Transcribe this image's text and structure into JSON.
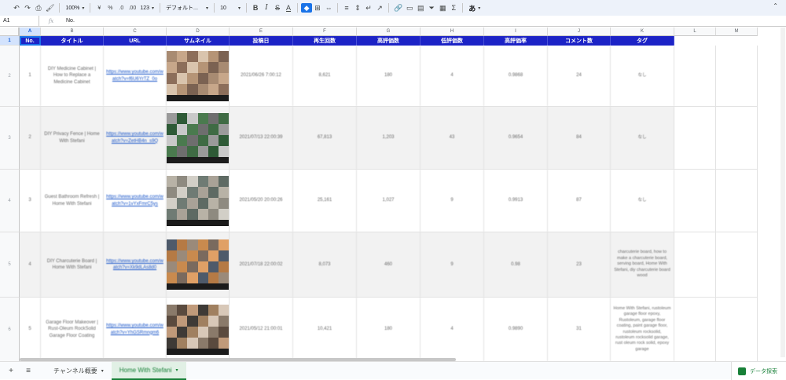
{
  "toolbar": {
    "zoom": "100%",
    "currency": "¥",
    "percent": "%",
    "dec_less": ".0",
    "dec_more": ".00",
    "num_format": "123",
    "font": "デフォルト...",
    "font_size": "10",
    "bold": "B",
    "italic": "I",
    "strike": "S",
    "text_color": "A",
    "ime": "あ"
  },
  "formula_bar": {
    "cell_ref": "A1",
    "fx": "fx",
    "content": "No."
  },
  "columns": [
    "A",
    "B",
    "C",
    "D",
    "E",
    "F",
    "G",
    "H",
    "I",
    "J",
    "K",
    "L",
    "M"
  ],
  "header": [
    "No.",
    "タイトル",
    "URL",
    "サムネイル",
    "投稿日",
    "再生回数",
    "高評価数",
    "低評価数",
    "高評価率",
    "コメント数",
    "タグ"
  ],
  "rows": [
    {
      "row_num": "2",
      "no": "1",
      "title": "DIY Medicine Cabinet | How to Replace a Medicine Cabinet",
      "url": "https://www.youtube.com/watch?v=f6U6YrTZ_0o",
      "date": "2021/06/26 7:00:12",
      "views": "8,621",
      "likes": "180",
      "dislikes": "4",
      "rate": "0.9868",
      "comments": "24",
      "tags": "なし"
    },
    {
      "row_num": "3",
      "no": "2",
      "title": "DIY Privacy Fence | Home With Stefani",
      "url": "https://www.youtube.com/watch?v=ZetHB4n_s9Q",
      "date": "2021/07/13 22:00:39",
      "views": "67,813",
      "likes": "1,203",
      "dislikes": "43",
      "rate": "0.9654",
      "comments": "84",
      "tags": "なし"
    },
    {
      "row_num": "4",
      "no": "3",
      "title": "Guest Bathroom Refresh | Home With Stefani",
      "url": "https://www.youtube.com/watch?v=1vYxFmrC5ys",
      "date": "2021/05/20 20:00:26",
      "views": "25,161",
      "likes": "1,027",
      "dislikes": "9",
      "rate": "0.9913",
      "comments": "87",
      "tags": "なし"
    },
    {
      "row_num": "5",
      "no": "4",
      "title": "DIY Charcuterie Board | Home With Stefani",
      "url": "https://www.youtube.com/watch?v=Xk9dLAs8d0",
      "date": "2021/07/18 22:00:02",
      "views": "8,073",
      "likes": "460",
      "dislikes": "9",
      "rate": "0.98",
      "comments": "23",
      "tags": "charcuterie board, how to make a charcuterie board, serving board, Home With Stefani, diy charcuterie board wood"
    },
    {
      "row_num": "6",
      "no": "5",
      "title": "Garage Floor Makeover | Rust-Oleum RockSolid Garage Floor Coating",
      "url": "https://www.youtube.com/watch?v=YhGSRmngm6",
      "date": "2021/05/12 21:00:01",
      "views": "10,421",
      "likes": "180",
      "dislikes": "4",
      "rate": "0.9890",
      "comments": "31",
      "tags": "Home With Stefani, rustoleum garage floor epoxy, Rustoleum, garage floor coating, paint garage floor, rustoleum rocksolid, rustoleum rocksolid garage, rust oleum rock solid, epoxy garage"
    }
  ],
  "tabs": {
    "add": "+",
    "list": "≡",
    "sheet1": "チャンネル概要",
    "sheet2": "Home With Stefani",
    "explore": "データ探索"
  }
}
